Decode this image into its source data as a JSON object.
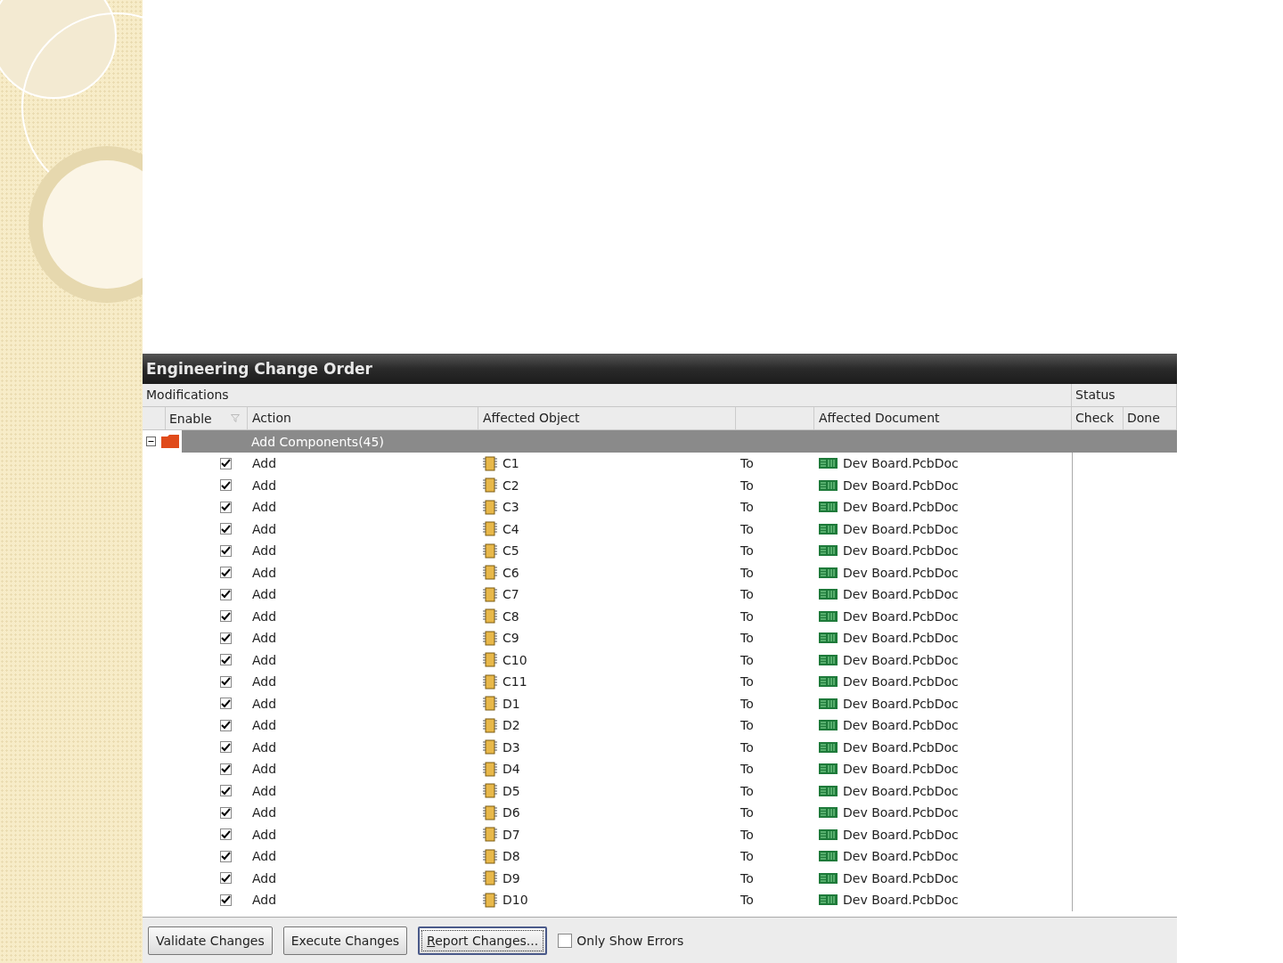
{
  "window": {
    "title": "Engineering Change Order"
  },
  "table": {
    "group_header": "Modifications",
    "status_header": "Status",
    "columns": [
      "Enable",
      "Action",
      "Affected Object",
      "Affected Document",
      "Check",
      "Done"
    ],
    "group": {
      "label": "Add Components(45)",
      "expanded": true
    },
    "rows": [
      {
        "checked": true,
        "action": "Add",
        "object": "C1",
        "to": "To",
        "document": "Dev Board.PcbDoc"
      },
      {
        "checked": true,
        "action": "Add",
        "object": "C2",
        "to": "To",
        "document": "Dev Board.PcbDoc"
      },
      {
        "checked": true,
        "action": "Add",
        "object": "C3",
        "to": "To",
        "document": "Dev Board.PcbDoc"
      },
      {
        "checked": true,
        "action": "Add",
        "object": "C4",
        "to": "To",
        "document": "Dev Board.PcbDoc"
      },
      {
        "checked": true,
        "action": "Add",
        "object": "C5",
        "to": "To",
        "document": "Dev Board.PcbDoc"
      },
      {
        "checked": true,
        "action": "Add",
        "object": "C6",
        "to": "To",
        "document": "Dev Board.PcbDoc"
      },
      {
        "checked": true,
        "action": "Add",
        "object": "C7",
        "to": "To",
        "document": "Dev Board.PcbDoc"
      },
      {
        "checked": true,
        "action": "Add",
        "object": "C8",
        "to": "To",
        "document": "Dev Board.PcbDoc"
      },
      {
        "checked": true,
        "action": "Add",
        "object": "C9",
        "to": "To",
        "document": "Dev Board.PcbDoc"
      },
      {
        "checked": true,
        "action": "Add",
        "object": "C10",
        "to": "To",
        "document": "Dev Board.PcbDoc"
      },
      {
        "checked": true,
        "action": "Add",
        "object": "C11",
        "to": "To",
        "document": "Dev Board.PcbDoc"
      },
      {
        "checked": true,
        "action": "Add",
        "object": "D1",
        "to": "To",
        "document": "Dev Board.PcbDoc"
      },
      {
        "checked": true,
        "action": "Add",
        "object": "D2",
        "to": "To",
        "document": "Dev Board.PcbDoc"
      },
      {
        "checked": true,
        "action": "Add",
        "object": "D3",
        "to": "To",
        "document": "Dev Board.PcbDoc"
      },
      {
        "checked": true,
        "action": "Add",
        "object": "D4",
        "to": "To",
        "document": "Dev Board.PcbDoc"
      },
      {
        "checked": true,
        "action": "Add",
        "object": "D5",
        "to": "To",
        "document": "Dev Board.PcbDoc"
      },
      {
        "checked": true,
        "action": "Add",
        "object": "D6",
        "to": "To",
        "document": "Dev Board.PcbDoc"
      },
      {
        "checked": true,
        "action": "Add",
        "object": "D7",
        "to": "To",
        "document": "Dev Board.PcbDoc"
      },
      {
        "checked": true,
        "action": "Add",
        "object": "D8",
        "to": "To",
        "document": "Dev Board.PcbDoc"
      },
      {
        "checked": true,
        "action": "Add",
        "object": "D9",
        "to": "To",
        "document": "Dev Board.PcbDoc"
      },
      {
        "checked": true,
        "action": "Add",
        "object": "D10",
        "to": "To",
        "document": "Dev Board.PcbDoc"
      }
    ]
  },
  "footer": {
    "buttons": [
      {
        "label": "Validate Changes",
        "focused": false
      },
      {
        "label": "Execute Changes",
        "focused": false
      },
      {
        "label": "Report Changes...",
        "focused": true
      }
    ],
    "checkbox": {
      "label": "Only Show Errors",
      "checked": false
    }
  }
}
